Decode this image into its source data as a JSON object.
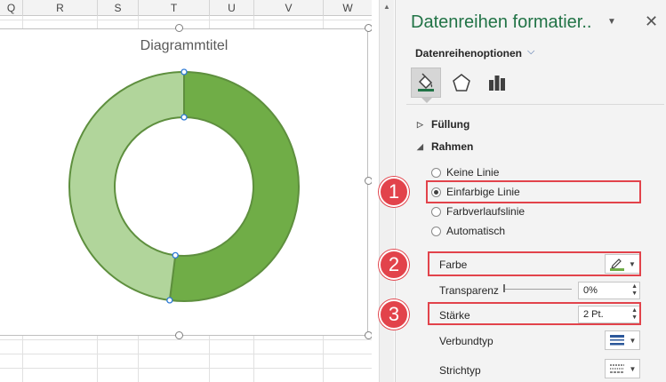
{
  "sheet": {
    "columns": [
      "Q",
      "R",
      "S",
      "T",
      "U",
      "V",
      "W"
    ]
  },
  "chart": {
    "title": "Diagrammtitel",
    "chart_data": {
      "type": "pie",
      "subtype": "doughnut",
      "values": [
        52,
        48
      ],
      "colors": [
        "#70ad47",
        "#b1d59b"
      ],
      "outline_color": "#5e8f3e"
    }
  },
  "pane": {
    "title": "Datenreihen formatier..",
    "dropdown_icon": "triangle-down",
    "close_icon": "close",
    "series_options_label": "Datenreihenoptionen",
    "tabs": [
      "fill-line",
      "effects",
      "series-options"
    ],
    "sections": {
      "fill_label": "Füllung",
      "border_label": "Rahmen"
    },
    "radio_options": [
      "Keine Linie",
      "Einfarbige Linie",
      "Farbverlaufslinie",
      "Automatisch"
    ],
    "selected_radio": "Einfarbige Linie",
    "color_label": "Farbe",
    "transparency_label": "Transparenz",
    "transparency_value": "0%",
    "width_label": "Stärke",
    "width_value": "2 Pt.",
    "compound_type_label": "Verbundtyp",
    "dash_type_label": "Strichtyp"
  },
  "callouts": [
    "1",
    "2",
    "3"
  ],
  "accent_color": "#217346",
  "callout_color": "#e2434b"
}
